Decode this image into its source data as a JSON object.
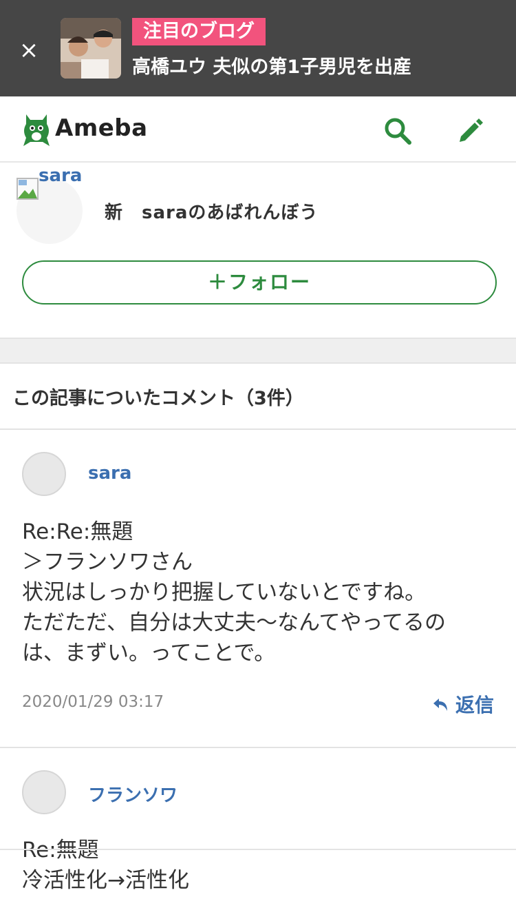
{
  "banner": {
    "tag": "注目のブログ",
    "title": "高橋ユウ 夫似の第1子男児を出産"
  },
  "header": {
    "logo_text": "Ameba"
  },
  "profile": {
    "alt_text": "sara",
    "blog_title": "新　saraのあばれんぼう",
    "follow_label": "＋フォロー"
  },
  "comments": {
    "heading": "この記事についたコメント（3件）",
    "items": [
      {
        "name": "sara",
        "lines": [
          "Re:Re:無題",
          "＞フランソワさん",
          "状況はしっかり把握していないとですね。",
          "ただただ、自分は大丈夫～なんてやってるの",
          "は、まずい。ってことで。"
        ],
        "date": "2020/01/29 03:17",
        "reply_label": "返信"
      },
      {
        "name": "フランソワ",
        "lines": [
          "Re:無題",
          "冷活性化→活性化"
        ]
      }
    ]
  },
  "colors": {
    "banner_bg": "#464646",
    "tag_bg": "#f2537d",
    "brand_green": "#2d8b3e",
    "link_blue": "#3b6fb0"
  }
}
